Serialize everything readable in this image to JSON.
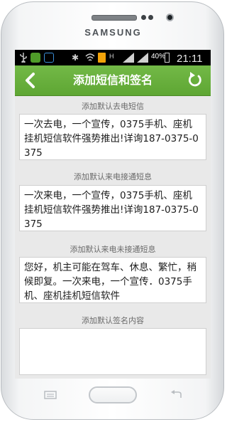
{
  "device": {
    "brand": "SAMSUNG"
  },
  "status_bar": {
    "network_type": "H",
    "battery_percent": "40%",
    "time": "21:11"
  },
  "header": {
    "title": "添加短信和签名",
    "back_icon": "chevron-left-icon",
    "refresh_icon": "refresh-icon"
  },
  "sections": [
    {
      "label": "添加默认去电短信",
      "value": "一次去电，一个宣传，0375手机、座机挂机短信软件强势推出!详询187-0375-0375"
    },
    {
      "label": "添加默认来电接通短息",
      "value": "一次来电，一个宣传，0375手机、座机挂机短信软件强势推出!详询187-0375-0375"
    },
    {
      "label": "添加默认来电未接通短息",
      "value": "您好，机主可能在驾车、休息、繁忙，稍候即复。一次来电，一个宣传．0375手机、座机挂机短信软件"
    },
    {
      "label": "添加默认签名内容",
      "value": ""
    }
  ],
  "colors": {
    "header_green": "#66ad3a",
    "screen_background": "#e9e9e9"
  }
}
